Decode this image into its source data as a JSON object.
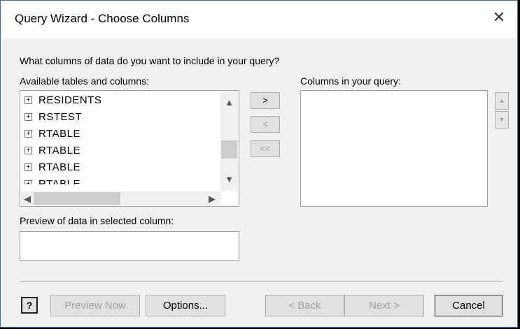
{
  "window": {
    "title": "Query Wizard - Choose Columns",
    "close_glyph": "✕"
  },
  "prompt": "What columns of data do you want to include in your query?",
  "available": {
    "label": "Available tables and columns:",
    "items": [
      "RESIDENTS",
      "RSTEST",
      "RTABLE",
      "RTABLE",
      "RTABLE",
      "RTABLE"
    ],
    "expand_glyph": "+",
    "scroll_up": "▲",
    "scroll_down": "▼",
    "scroll_left": "◀",
    "scroll_right": "▶"
  },
  "move_buttons": {
    "add": ">",
    "remove": "<",
    "remove_all": "<<"
  },
  "query_columns": {
    "label": "Columns in your query:",
    "items": []
  },
  "order_buttons": {
    "up": "▲",
    "down": "▼"
  },
  "preview": {
    "label": "Preview of data in selected column:",
    "value": ""
  },
  "footer": {
    "help_glyph": "?",
    "preview_now": "Preview Now",
    "options": "Options...",
    "back": "< Back",
    "next": "Next >",
    "cancel": "Cancel"
  }
}
